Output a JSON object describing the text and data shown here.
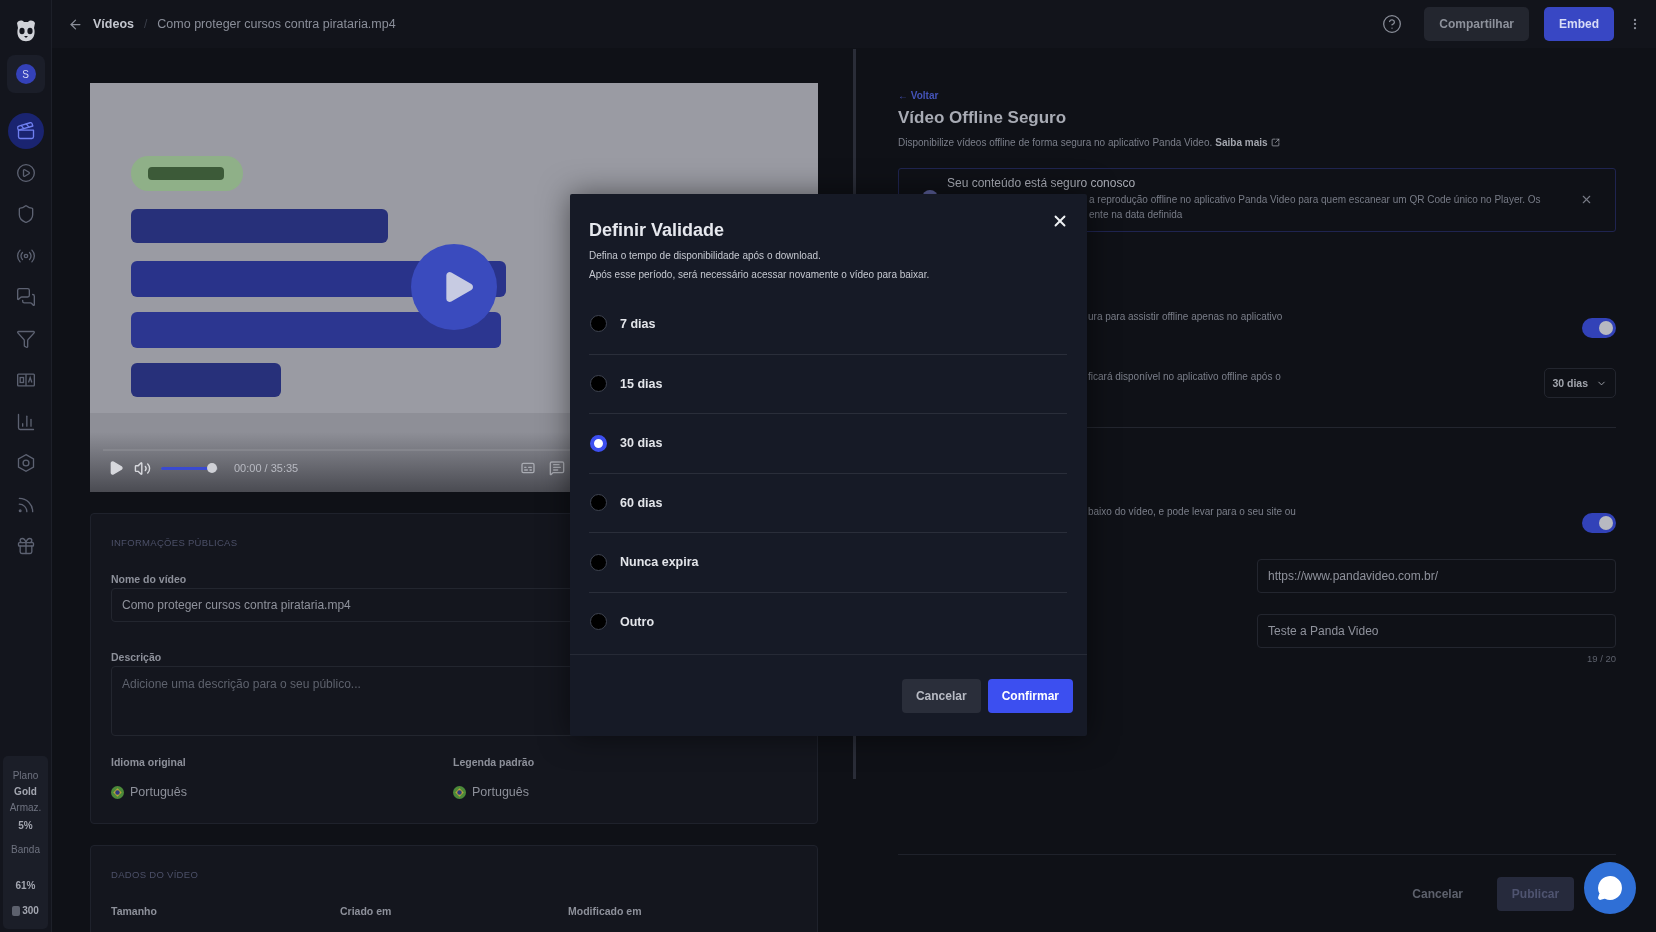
{
  "topbar": {
    "breadcrumb": [
      "Vídeos",
      "Como proteger cursos contra pirataria.mp4"
    ],
    "separator": "/",
    "share": "Compartilhar",
    "embed": "Embed"
  },
  "sidebar": {
    "avatar": "S",
    "nav": [
      {
        "selected": true
      },
      {
        "selected": false
      },
      {
        "selected": false
      },
      {
        "selected": false
      },
      {
        "selected": false
      },
      {
        "selected": false
      },
      {
        "selected": false
      },
      {
        "selected": false
      },
      {
        "selected": false
      },
      {
        "selected": false
      },
      {
        "selected": false
      }
    ],
    "plan": {
      "label": "Plano",
      "tier": "Gold",
      "storage_label": "Armaz.",
      "storage": "5%",
      "bandwidth_label": "Banda",
      "bandwidth": "61%",
      "credits": "300"
    }
  },
  "video": {
    "kind": "picture",
    "time": "00:00 / 35:35",
    "volume": {
      "level": 0.9
    }
  },
  "public_info": {
    "heading": "INFORMAÇÕES PÚBLICAS",
    "name_label": "Nome do vídeo",
    "name_value": "Como proteger cursos contra pirataria.mp4",
    "description_label": "Descrição",
    "description_placeholder": "Adicione uma descrição para o seu público...",
    "languages": [
      {
        "label": "Idioma original",
        "value": "Português"
      },
      {
        "label": "Legenda padrão",
        "value": "Português"
      }
    ]
  },
  "video_data": {
    "heading": "DADOS DO VÍDEO",
    "columns": [
      "Tamanho",
      "Criado em",
      "Modificado em"
    ]
  },
  "offline_panel": {
    "back": "← Voltar",
    "title": "Vídeo Offline Seguro",
    "description": "Disponibilize vídeos offline de forma segura no aplicativo Panda Video.",
    "link": "Saiba mais",
    "notice": {
      "title": "Seu conteúdo está seguro conosco",
      "lines": [
        "a reprodução offline no aplicativo Panda Video para quem escanear um QR Code único no Player. Os",
        "ente na data definida"
      ]
    },
    "sections": [
      {
        "settings": [
          {
            "kind": "toggle",
            "text": "ura para assistir offline apenas no aplicativo",
            "on": true
          },
          {
            "kind": "select",
            "text": "ficará disponível no aplicativo offline após o",
            "value": "30 dias"
          }
        ]
      },
      {
        "settings": [
          {
            "kind": "toggle",
            "text": "baixo do vídeo, e pode levar para o seu site ou",
            "on": true
          }
        ],
        "fields": [
          {
            "value": "https://www.pandavideo.com.br/"
          },
          {
            "value": "Teste a Panda Video",
            "counter": "19 / 20"
          }
        ]
      }
    ],
    "footer": {
      "cancel": "Cancelar",
      "publish": "Publicar",
      "publish_disabled": true
    }
  },
  "modal": {
    "title": "Definir Validade",
    "lines": [
      "Defina o tempo de disponibilidade após o download.",
      "Após esse período, será necessário acessar novamente o vídeo para baixar."
    ],
    "options": [
      {
        "label": "7 dias",
        "selected": false
      },
      {
        "label": "15 dias",
        "selected": false
      },
      {
        "label": "30 dias",
        "selected": true
      },
      {
        "label": "60 dias",
        "selected": false
      },
      {
        "label": "Nunca expira",
        "selected": false
      },
      {
        "label": "Outro",
        "selected": false
      }
    ],
    "cancel": "Cancelar",
    "confirm": "Confirmar"
  }
}
